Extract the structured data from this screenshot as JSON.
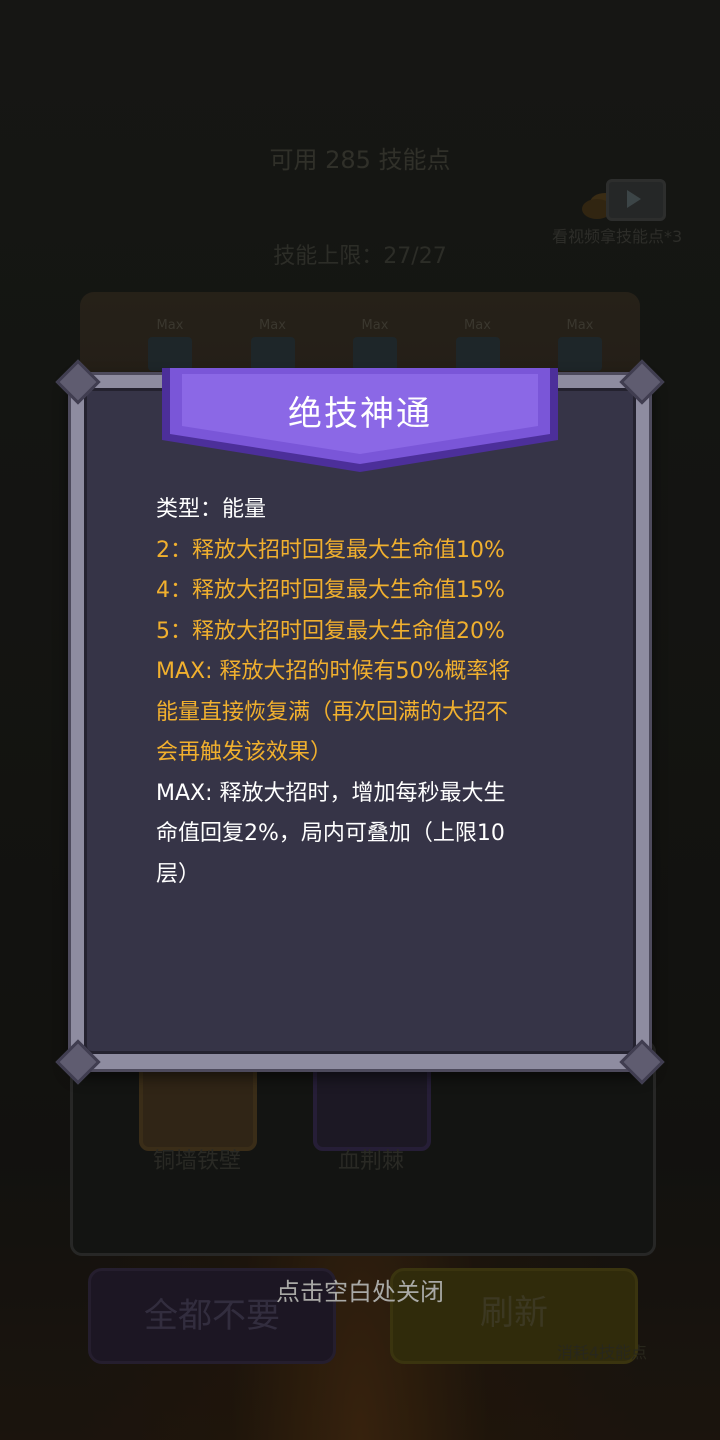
{
  "header": {
    "available_points": "可用 285 技能点",
    "video_reward_label": "看视频拿技能点*3",
    "skill_limit": "技能上限：27/27"
  },
  "book": {
    "tab_labels": [
      "Max",
      "Max",
      "Max",
      "Max",
      "Max"
    ]
  },
  "skill_choices": [
    {
      "name": "铜墙铁壁"
    },
    {
      "name": "血荆棘"
    }
  ],
  "buttons": {
    "reject_all": "全都不要",
    "refresh": "刷新",
    "refresh_cost": "消耗4技能点"
  },
  "hint": {
    "tap_to_close": "点击空白处关闭"
  },
  "modal": {
    "title": "绝技神通",
    "type_line": "类型：能量",
    "gold_lines": [
      "2：释放大招时回复最大生命值10%",
      "4：释放大招时回复最大生命值15%",
      "5：释放大招时回复最大生命值20%",
      "MAX: 释放大招的时候有50%概率将",
      "能量直接恢复满（再次回满的大招不",
      "会再触发该效果）"
    ],
    "white_lines": [
      "MAX: 释放大招时，增加每秒最大生",
      "命值回复2%，局内可叠加（上限10",
      "层）"
    ]
  },
  "colors": {
    "accent_gold": "#f1b02e",
    "banner_purple": "#7a56d8",
    "panel_bg": "#363447"
  }
}
